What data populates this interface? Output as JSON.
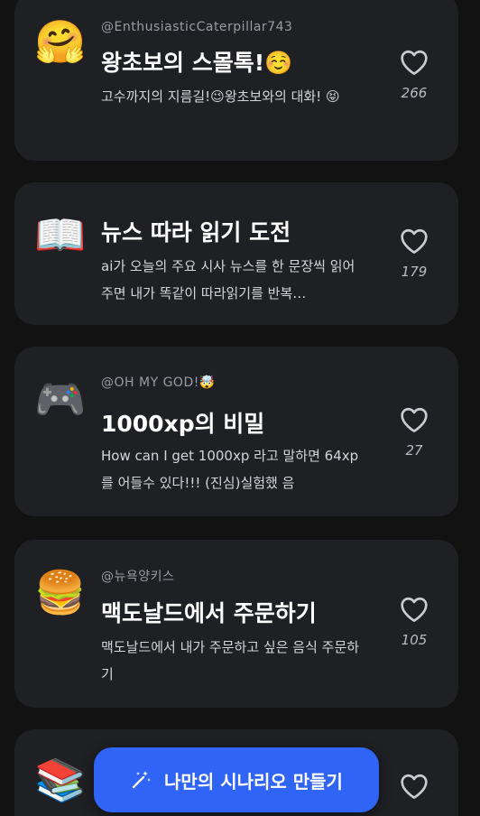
{
  "scenarios": [
    {
      "emoji": "🤗",
      "author": "@EnthusiasticCaterpillar743",
      "title": "왕초보의 스몰톡!☺️",
      "description": "고수까지의 지름길!😉왕초보와의 대화! 😝",
      "likes": "266"
    },
    {
      "emoji": "📖",
      "author": "",
      "title": "뉴스 따라 읽기 도전",
      "description": "ai가 오늘의 주요 시사 뉴스를 한 문장씩 읽어주면 내가 똑같이 따라읽기를 반복…",
      "likes": "179"
    },
    {
      "emoji": "🎮",
      "author": "@OH MY GOD!🤯",
      "title": "1000xp의 비밀",
      "description": "How can I get 1000xp 라고  말하면 64xp를 어들수 있다!!! (진심)실험했 음",
      "likes": "27"
    },
    {
      "emoji": "🍔",
      "author": "@뉴욕양키스",
      "title": "맥도날드에서 주문하기",
      "description": "맥도날드에서 내가 주문하고 싶은 음식 주문하기",
      "likes": "105"
    },
    {
      "emoji": "📚",
      "author": "",
      "title": "",
      "description": "",
      "likes": ""
    }
  ],
  "create_button": {
    "label": "나만의 시나리오 만들기",
    "icon": "magic-wand-icon"
  },
  "colors": {
    "background": "#121212",
    "card": "#1f2024",
    "accent": "#2f64f6"
  }
}
